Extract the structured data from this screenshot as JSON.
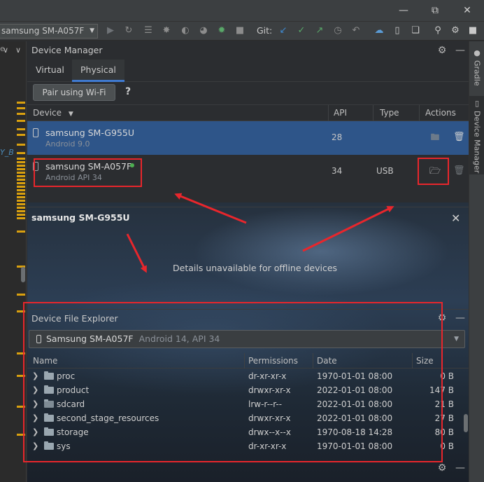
{
  "toolbar": {
    "device_combo": "samsung SM-A057F",
    "git_label": "Git:"
  },
  "editor": {
    "gutter_texts": [
      "e",
      "Y_B"
    ]
  },
  "right_strip": {
    "gradle_label": "Gradle",
    "device_manager_label": "Device Manager"
  },
  "device_manager": {
    "title": "Device Manager",
    "tabs": [
      "Virtual",
      "Physical"
    ],
    "active_tab": "Physical",
    "pair_button": "Pair using Wi-Fi",
    "help": "?",
    "columns": {
      "device": "Device",
      "api": "API",
      "type": "Type",
      "actions": "Actions"
    },
    "devices": [
      {
        "name": "samsung SM-G955U",
        "subtitle": "Android 9.0",
        "api": "28",
        "type": "",
        "online": false,
        "selected": true
      },
      {
        "name": "samsung SM-A057F",
        "subtitle": "Android API 34",
        "api": "34",
        "type": "USB",
        "online": true,
        "selected": false
      }
    ],
    "details": {
      "title": "samsung SM-G955U",
      "message": "Details unavailable for offline devices"
    }
  },
  "file_explorer": {
    "title": "Device File Explorer",
    "device_selector": {
      "name": "Samsung SM-A057F",
      "detail": "Android 14, API 34"
    },
    "columns": {
      "name": "Name",
      "permissions": "Permissions",
      "date": "Date",
      "size": "Size"
    },
    "rows": [
      {
        "name": "proc",
        "permissions": "dr-xr-xr-x",
        "date": "1970-01-01 08:00",
        "size": "0 B",
        "link": false
      },
      {
        "name": "product",
        "permissions": "drwxr-xr-x",
        "date": "2022-01-01 08:00",
        "size": "147 B",
        "link": false
      },
      {
        "name": "sdcard",
        "permissions": "lrw-r--r--",
        "date": "2022-01-01 08:00",
        "size": "21 B",
        "link": true
      },
      {
        "name": "second_stage_resources",
        "permissions": "drwxr-xr-x",
        "date": "2022-01-01 08:00",
        "size": "27 B",
        "link": false
      },
      {
        "name": "storage",
        "permissions": "drwx--x--x",
        "date": "1970-08-18 14:28",
        "size": "80 B",
        "link": false
      },
      {
        "name": "sys",
        "permissions": "dr-xr-xr-x",
        "date": "1970-01-01 08:00",
        "size": "0 B",
        "link": false
      }
    ]
  },
  "annotation_color": "#e8262c",
  "selection_color": "#2e5589",
  "accent_color": "#3f7ad1"
}
